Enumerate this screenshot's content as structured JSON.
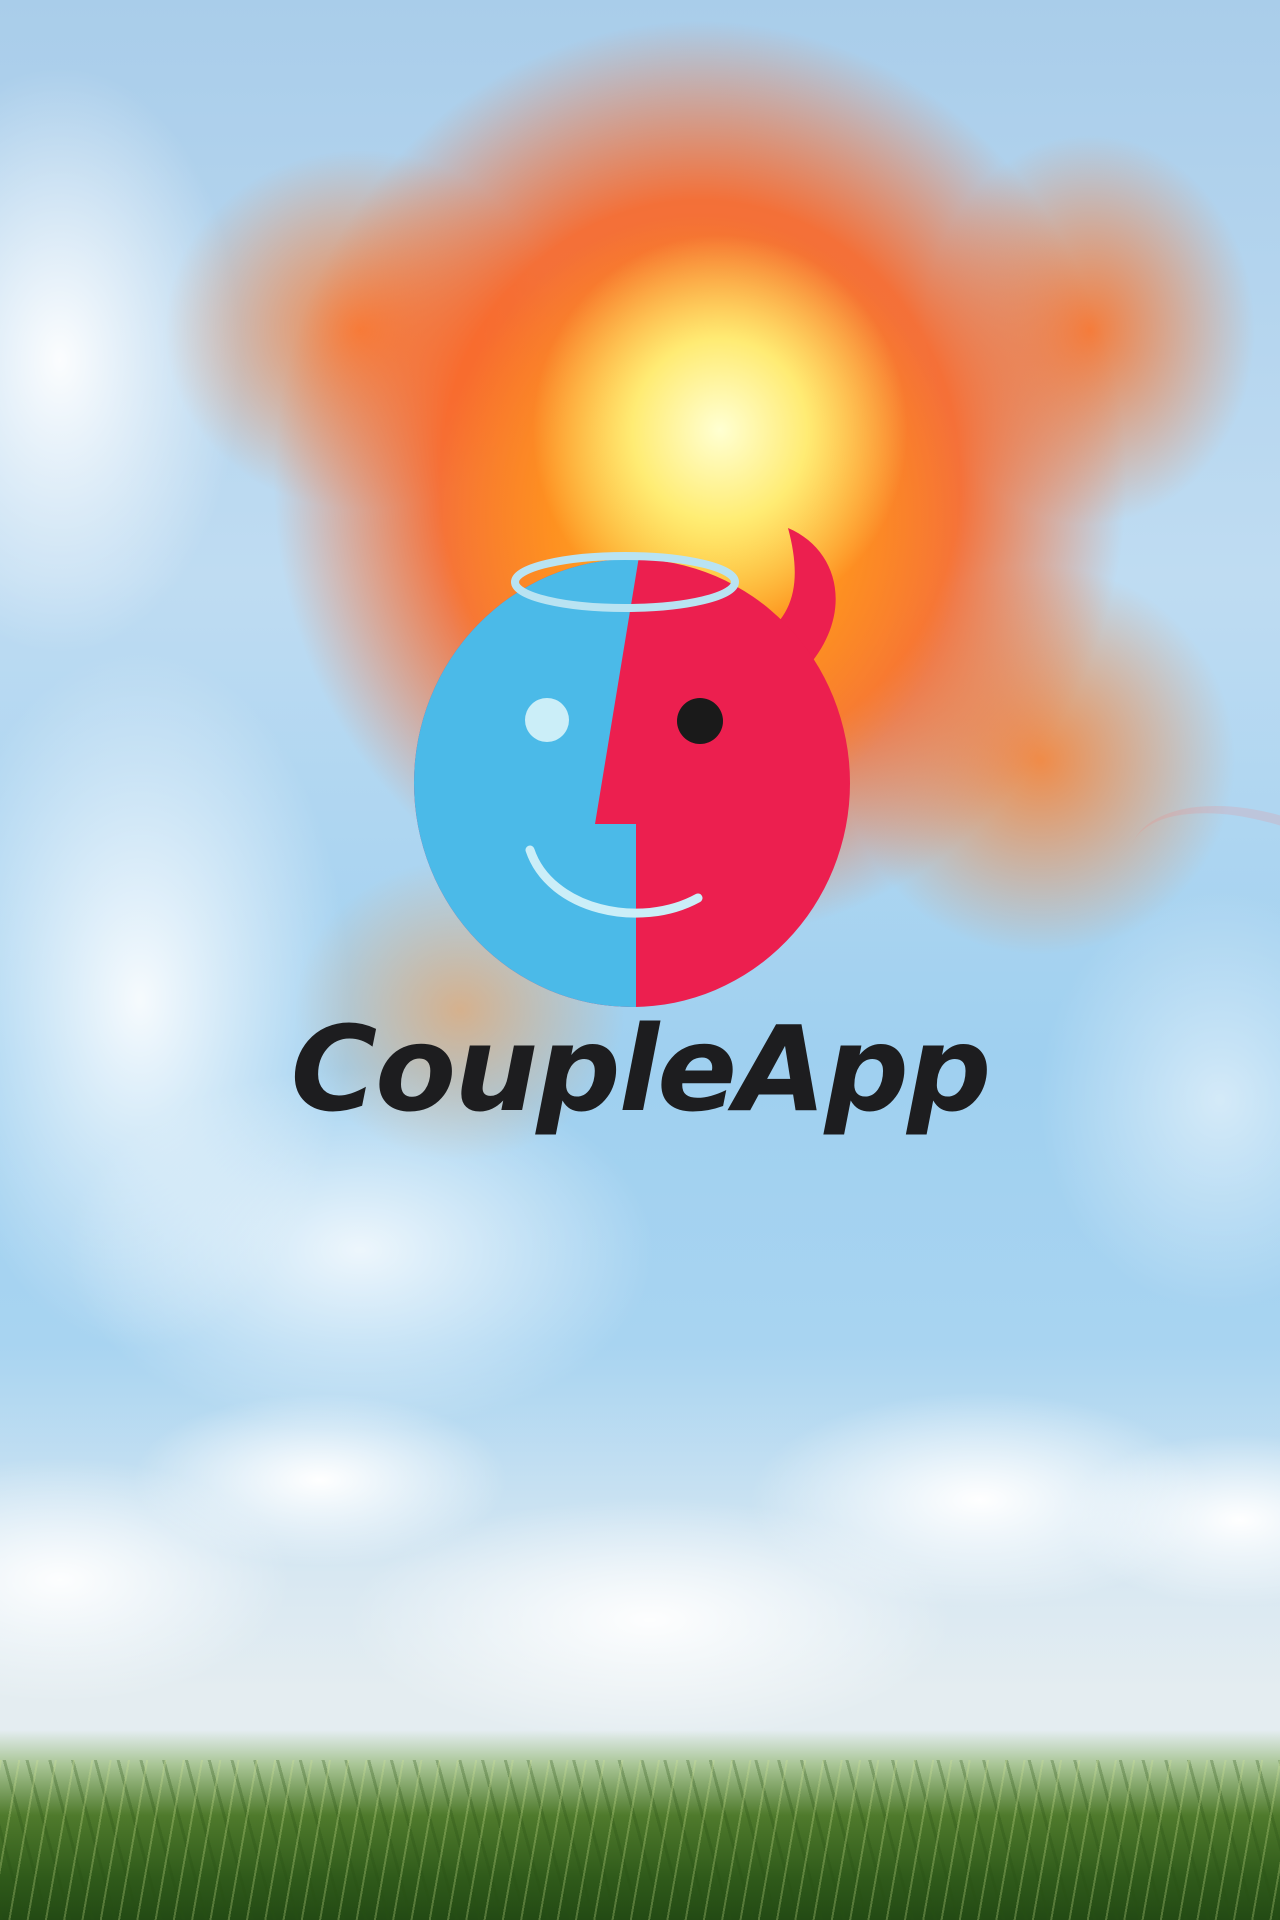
{
  "app": {
    "name": "CoupleApp"
  },
  "logo": {
    "icon": "angel-devil-face-logo",
    "colors": {
      "angel_blue": "#4bbae8",
      "devil_red": "#ec1f4f",
      "halo": "#b9e3f2",
      "eye_light": "#cbeef8",
      "eye_dark": "#1a1a1a",
      "wordmark": "#1d1d1f"
    }
  },
  "background": {
    "scene": "sky-explosion-clouds-grass",
    "colors": {
      "sky": "#a8d4f1",
      "fire_core": "#fff2a0",
      "fire_outer": "#ff6a1e",
      "cloud": "#ffffff",
      "grass": "#2f5a1a"
    }
  }
}
